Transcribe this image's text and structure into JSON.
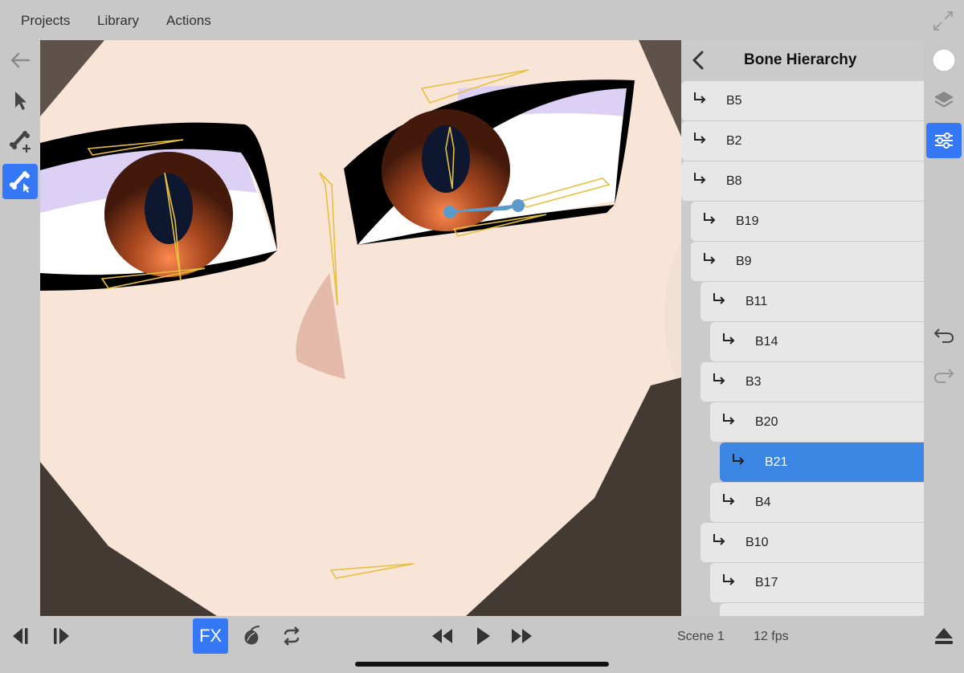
{
  "menu": {
    "projects": "Projects",
    "library": "Library",
    "actions": "Actions"
  },
  "panel": {
    "title": "Bone Hierarchy",
    "bones": [
      {
        "label": "B5",
        "selected": false
      },
      {
        "label": "B2",
        "selected": false
      },
      {
        "label": "B8",
        "selected": false
      },
      {
        "label": "B19",
        "selected": false
      },
      {
        "label": "B9",
        "selected": false
      },
      {
        "label": "B11",
        "selected": false
      },
      {
        "label": "B14",
        "selected": false
      },
      {
        "label": "B3",
        "selected": false
      },
      {
        "label": "B20",
        "selected": false
      },
      {
        "label": "B21",
        "selected": true
      },
      {
        "label": "B4",
        "selected": false
      },
      {
        "label": "B10",
        "selected": false
      },
      {
        "label": "B17",
        "selected": false
      }
    ]
  },
  "bottom": {
    "fx_label": "FX",
    "scene": "Scene 1",
    "fps": "12 fps"
  },
  "icons": {
    "back": "back-arrow-icon",
    "select": "pointer-icon",
    "add_bone": "add-bone-icon",
    "bone_select": "bone-select-icon",
    "color": "color-swatch-icon",
    "layers": "layers-icon",
    "settings": "sliders-icon",
    "undo": "undo-icon",
    "redo": "redo-icon",
    "expand": "expand-icon"
  },
  "colors": {
    "accent": "#3478f6",
    "selected_row": "#3a86e2",
    "bone_outline": "#e6bf3e"
  }
}
